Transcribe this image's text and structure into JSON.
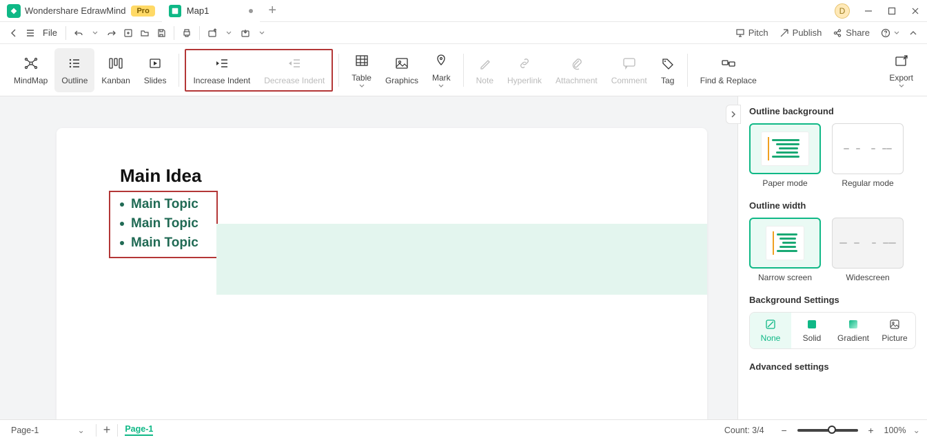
{
  "app": {
    "name": "Wondershare EdrawMind",
    "pro_label": "Pro",
    "avatar_letter": "D"
  },
  "tabs": {
    "doc_name": "Map1"
  },
  "toprow": {
    "file_label": "File",
    "pitch": "Pitch",
    "publish": "Publish",
    "share": "Share"
  },
  "ribbon": {
    "mindmap": "MindMap",
    "outline": "Outline",
    "kanban": "Kanban",
    "slides": "Slides",
    "increase_indent": "Increase Indent",
    "decrease_indent": "Decrease Indent",
    "table": "Table",
    "graphics": "Graphics",
    "mark": "Mark",
    "note": "Note",
    "hyperlink": "Hyperlink",
    "attachment": "Attachment",
    "comment": "Comment",
    "tag": "Tag",
    "find_replace": "Find & Replace",
    "export": "Export"
  },
  "outline": {
    "main_idea": "Main Idea",
    "topics": [
      "Main Topic",
      "Main Topic",
      "Main Topic"
    ]
  },
  "rpanel": {
    "outline_background": "Outline background",
    "paper_mode": "Paper mode",
    "regular_mode": "Regular mode",
    "outline_width": "Outline width",
    "narrow_screen": "Narrow screen",
    "widescreen": "Widescreen",
    "background_settings": "Background Settings",
    "none": "None",
    "solid": "Solid",
    "gradient": "Gradient",
    "picture": "Picture",
    "advanced_settings": "Advanced settings"
  },
  "statusbar": {
    "page_sel": "Page-1",
    "active_page": "Page-1",
    "count_label": "Count: 3/4",
    "zoom": "100%"
  }
}
